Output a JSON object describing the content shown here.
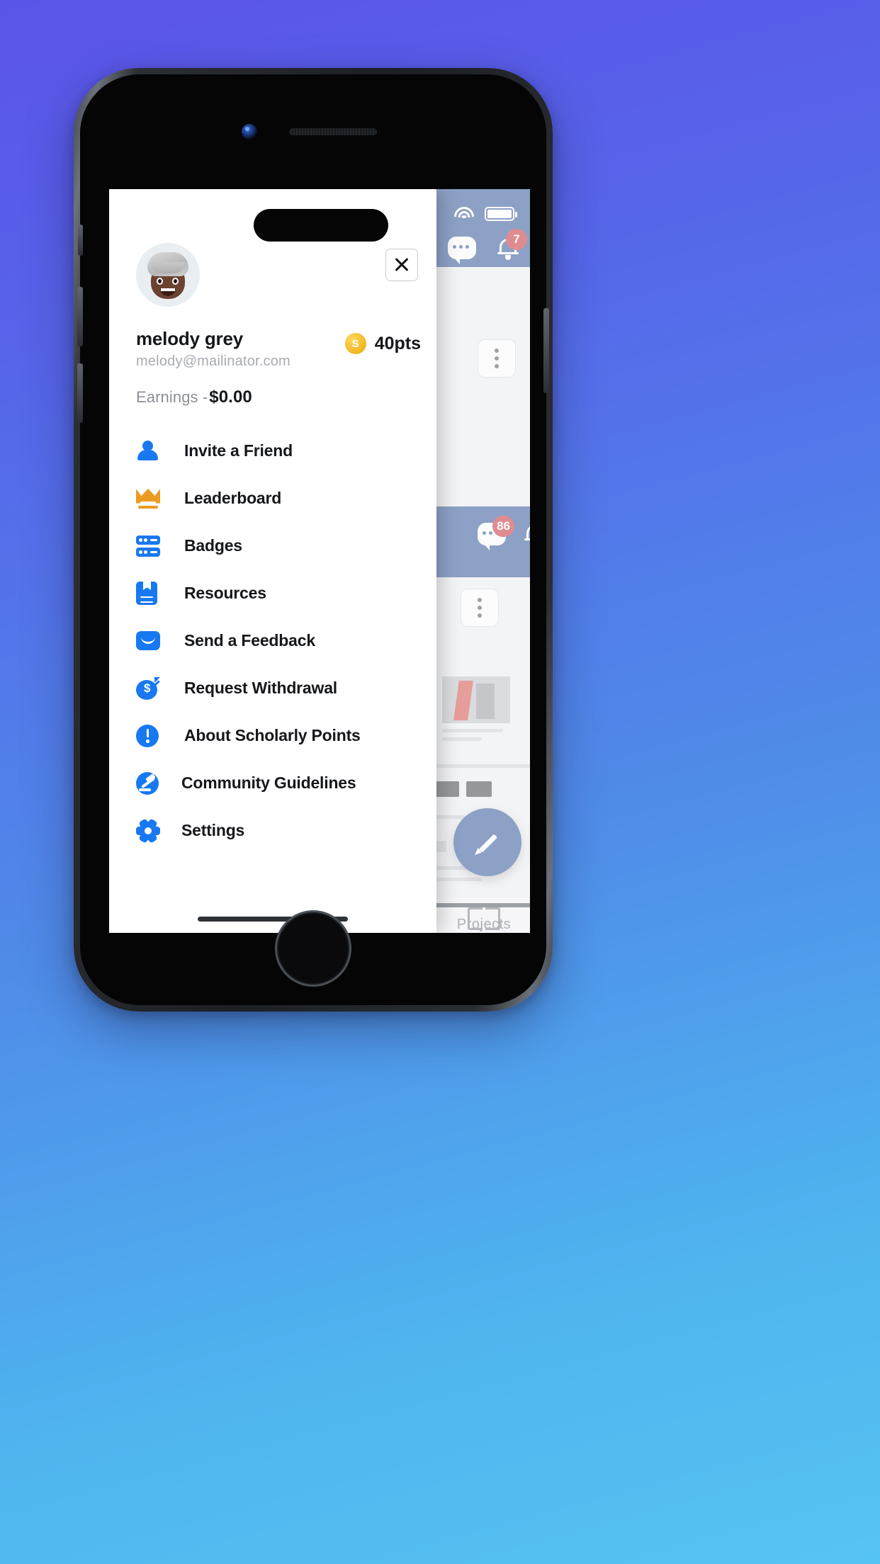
{
  "status_bar": {
    "wifi_icon": "wifi-icon",
    "battery_icon": "battery-icon"
  },
  "background_app": {
    "chat_icon": "chat-icon",
    "bell_icon": "bell-icon",
    "notification_badge_top": "7",
    "notification_badge_mid": "86",
    "kebab_icon": "kebab-menu-icon",
    "compose_icon": "pencil-icon",
    "tab_label": "Projects",
    "tab_icon": "book-icon"
  },
  "drawer": {
    "close_label": "close-icon",
    "avatar_alt": "user-avatar",
    "profile": {
      "name": "melody grey",
      "email": "melody@mailinator.com"
    },
    "points": {
      "coin_symbol": "S",
      "value": "40pts"
    },
    "earnings": {
      "label": "Earnings -",
      "amount": "$0.00"
    },
    "menu_items": [
      {
        "label": "Invite a Friend",
        "icon": "person-icon"
      },
      {
        "label": "Leaderboard",
        "icon": "crown-icon"
      },
      {
        "label": "Badges",
        "icon": "badges-icon"
      },
      {
        "label": "Resources",
        "icon": "bookmark-book-icon"
      },
      {
        "label": "Send a Feedback",
        "icon": "envelope-icon"
      },
      {
        "label": "Request Withdrawal",
        "icon": "money-bag-icon"
      },
      {
        "label": "About Scholarly Points",
        "icon": "info-circle-icon"
      },
      {
        "label": "Community Guidelines",
        "icon": "gavel-icon"
      },
      {
        "label": "Settings",
        "icon": "gear-icon"
      }
    ]
  },
  "colors": {
    "accent_blue": "#1878f2",
    "header_navy": "#17418c",
    "crown_orange": "#eb9a22",
    "coin_yellow": "#f0b721",
    "badge_red": "#c3161c",
    "background_gradient_start": "#5b54e8",
    "background_gradient_end": "#56c4f2"
  }
}
